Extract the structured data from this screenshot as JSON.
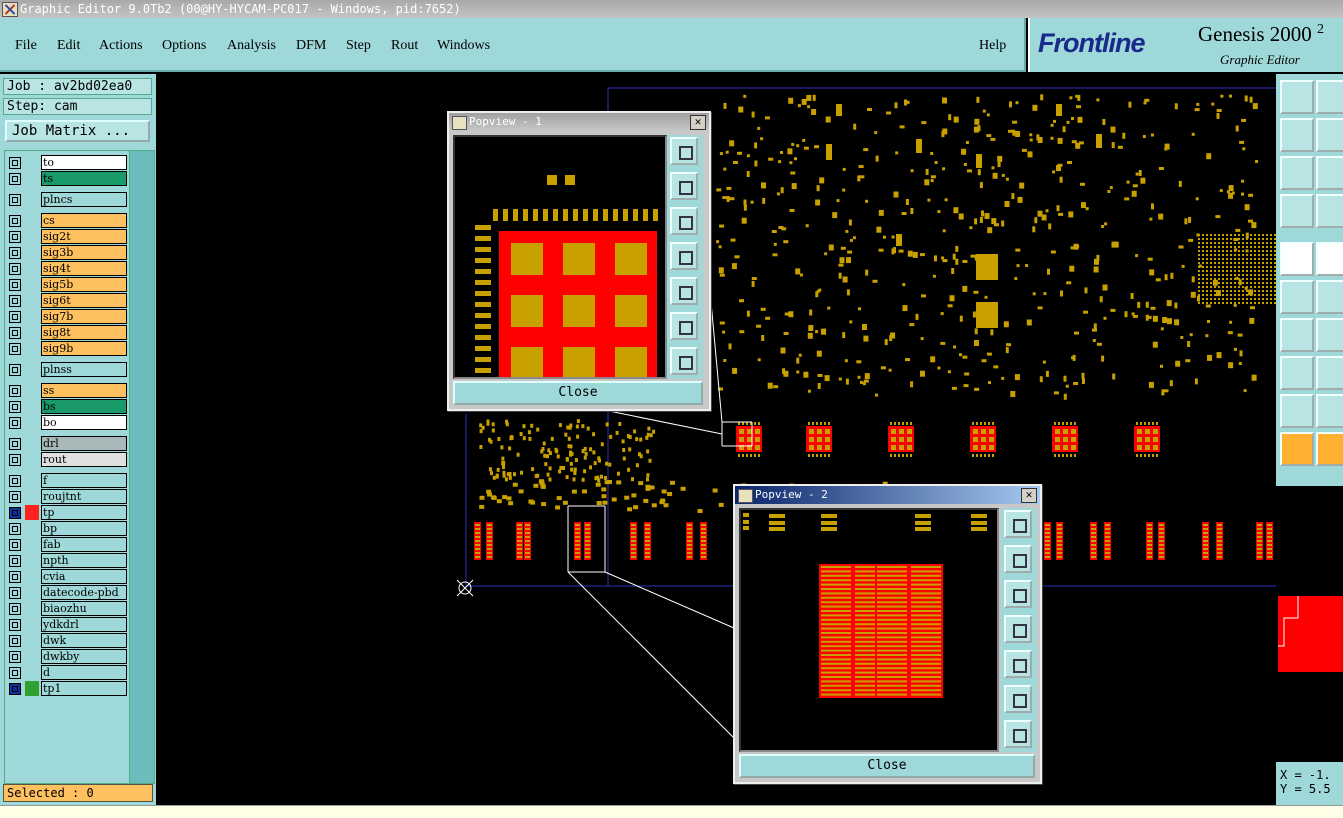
{
  "window": {
    "title": "Graphic Editor 9.0Tb2 (00@HY-HYCAM-PC017 - Windows, pid:7652)"
  },
  "menu": [
    "File",
    "Edit",
    "Actions",
    "Options",
    "Analysis",
    "DFM",
    "Step",
    "Rout",
    "Windows"
  ],
  "help": "Help",
  "logo": {
    "brand": "Frontline",
    "product": "Genesis 2000",
    "product_suffix": "2",
    "subtitle": "Graphic Editor"
  },
  "job": {
    "label": "Job : av2bd02ea0",
    "step": "Step: cam",
    "matrix": "Job Matrix ..."
  },
  "layers": [
    {
      "name": "to",
      "color": "#ffffff"
    },
    {
      "name": "ts",
      "color": "#1a9a6a"
    },
    {
      "name": "plncs",
      "color": "#9ed8d8",
      "gap": true
    },
    {
      "name": "cs",
      "color": "#ffc060",
      "gap": true
    },
    {
      "name": "sig2t",
      "color": "#ffc060"
    },
    {
      "name": "sig3b",
      "color": "#ffc060"
    },
    {
      "name": "sig4t",
      "color": "#ffc060"
    },
    {
      "name": "sig5b",
      "color": "#ffc060"
    },
    {
      "name": "sig6t",
      "color": "#ffc060"
    },
    {
      "name": "sig7b",
      "color": "#ffc060"
    },
    {
      "name": "sig8t",
      "color": "#ffc060"
    },
    {
      "name": "sig9b",
      "color": "#ffc060"
    },
    {
      "name": "plnss",
      "color": "#9ed8d8",
      "gap": true
    },
    {
      "name": "ss",
      "color": "#ffc060",
      "gap": true
    },
    {
      "name": "bs",
      "color": "#1a9a6a"
    },
    {
      "name": "bo",
      "color": "#ffffff"
    },
    {
      "name": "drl",
      "color": "#a8b8b8",
      "gap": true
    },
    {
      "name": "rout",
      "color": "#e0e0e0"
    },
    {
      "name": "f",
      "color": "#9ed8d8",
      "gap": true
    },
    {
      "name": "roujtnt",
      "color": "#9ed8d8"
    },
    {
      "name": "tp",
      "color": "#9ed8d8",
      "active": "#ff2020"
    },
    {
      "name": "bp",
      "color": "#9ed8d8"
    },
    {
      "name": "fab",
      "color": "#9ed8d8"
    },
    {
      "name": "npth",
      "color": "#9ed8d8"
    },
    {
      "name": "cvia",
      "color": "#9ed8d8"
    },
    {
      "name": "datecode-pbd",
      "color": "#9ed8d8"
    },
    {
      "name": "biaozhu",
      "color": "#9ed8d8"
    },
    {
      "name": "ydkdrl",
      "color": "#9ed8d8"
    },
    {
      "name": "dwk",
      "color": "#9ed8d8"
    },
    {
      "name": "dwkby",
      "color": "#9ed8d8"
    },
    {
      "name": "d",
      "color": "#9ed8d8"
    },
    {
      "name": "tp1",
      "color": "#9ed8d8",
      "active": "#30a030"
    }
  ],
  "status": {
    "selected": "Selected : 0"
  },
  "popup1": {
    "title": "Popview - 1",
    "close": "Close"
  },
  "popup2": {
    "title": "Popview - 2",
    "close": "Close"
  },
  "coords": {
    "x": "X = -1.",
    "y": "Y = 5.5"
  },
  "colors": {
    "pad": "#c8a000",
    "copper": "#ff0000",
    "panel": "#9ed8d8",
    "outline": "#3030c0"
  }
}
